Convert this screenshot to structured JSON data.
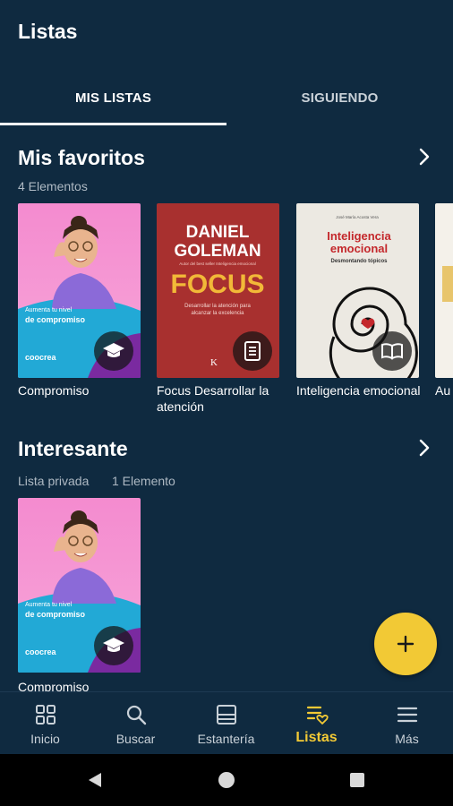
{
  "header": {
    "title": "Listas"
  },
  "tabs": [
    {
      "label": "MIS LISTAS",
      "active": true
    },
    {
      "label": "SIGUIENDO",
      "active": false
    }
  ],
  "sections": [
    {
      "title": "Mis favoritos",
      "subtitle": "4 Elementos",
      "books": [
        {
          "label": "Compromiso",
          "badge": "graduation-cap-icon"
        },
        {
          "label": "Focus Desarrollar la atención",
          "badge": "document-icon"
        },
        {
          "label": "Inteligencia emocional",
          "badge": "book-open-icon"
        },
        {
          "label": "Au",
          "badge": ""
        }
      ]
    },
    {
      "title": "Interesante",
      "subtitle_privacy": "Lista privada",
      "subtitle_count": "1 Elemento",
      "books": [
        {
          "label": "Compromiso",
          "badge": "graduation-cap-icon"
        }
      ]
    }
  ],
  "covers": {
    "compromiso": {
      "line1": "Aumenta tu nivel",
      "line2": "de compromiso",
      "brand": "coocrea"
    },
    "focus": {
      "author1": "DANIEL",
      "author2": "GOLEMAN",
      "small": "Autor del best seller Inteligencia emocional",
      "title": "FOCUS",
      "sub1": "Desarrollar la atención para",
      "sub2": "alcanzar la excelencia",
      "publisher": "K"
    },
    "inteligencia": {
      "author": "José María Acosta Vera",
      "title1": "Inteligencia",
      "title2": "emocional",
      "subtitle": "Desmontando tópicos"
    }
  },
  "fab": {
    "icon": "plus-icon"
  },
  "bottom_nav": [
    {
      "label": "Inicio",
      "icon": "grid-icon",
      "active": false
    },
    {
      "label": "Buscar",
      "icon": "search-icon",
      "active": false
    },
    {
      "label": "Estantería",
      "icon": "shelf-icon",
      "active": false
    },
    {
      "label": "Listas",
      "icon": "list-heart-icon",
      "active": true
    },
    {
      "label": "Más",
      "icon": "menu-icon",
      "active": false
    }
  ],
  "colors": {
    "background": "#0f2a40",
    "accent": "#f2c935",
    "muted": "#aeb9c3"
  }
}
